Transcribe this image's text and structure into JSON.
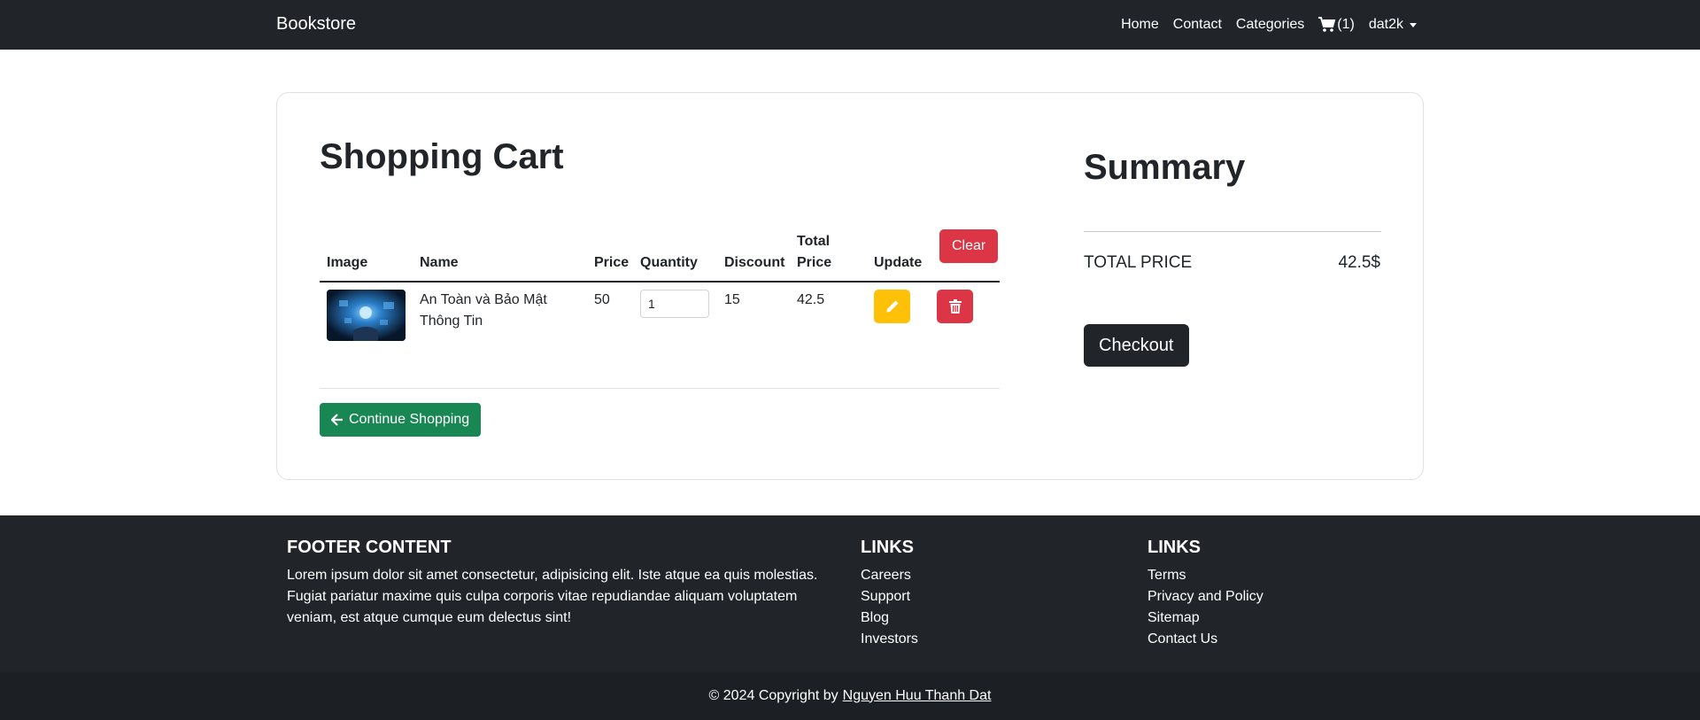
{
  "navbar": {
    "brand": "Bookstore",
    "links": {
      "home": "Home",
      "contact": "Contact",
      "categories": "Categories"
    },
    "cart_count": "(1)",
    "user": "dat2k"
  },
  "cart": {
    "title": "Shopping Cart",
    "headers": {
      "image": "Image",
      "name": "Name",
      "price": "Price",
      "quantity": "Quantity",
      "discount": "Discount",
      "total_line1": "Total",
      "total_line2": "Price",
      "update": "Update"
    },
    "clear_label": "Clear",
    "items": [
      {
        "name_line1": "An Toàn và Bảo Mật",
        "name_line2": "Thông Tin",
        "price": "50",
        "quantity": "1",
        "discount": "15",
        "total": "42.5"
      }
    ],
    "continue_label": "Continue Shopping"
  },
  "summary": {
    "title": "Summary",
    "total_label": "TOTAL PRICE",
    "total_value": "42.5$",
    "checkout_label": "Checkout"
  },
  "footer": {
    "content_title": "FOOTER CONTENT",
    "content_text": "Lorem ipsum dolor sit amet consectetur, adipisicing elit. Iste atque ea quis molestias. Fugiat pariatur maxime quis culpa corporis vitae repudiandae aliquam voluptatem veniam, est atque cumque eum delectus sint!",
    "links1_title": "LINKS",
    "links1": [
      "Careers",
      "Support",
      "Blog",
      "Investors"
    ],
    "links2_title": "LINKS",
    "links2": [
      "Terms",
      "Privacy and Policy",
      "Sitemap",
      "Contact Us"
    ],
    "copyright_prefix": "© 2024 Copyright by",
    "copyright_author": "Nguyen Huu Thanh Dat"
  },
  "colors": {
    "dark": "#212529",
    "danger": "#dc3545",
    "warning": "#ffc107",
    "success": "#198754"
  },
  "icons": [
    "cart-icon",
    "caret-down-icon",
    "pencil-icon",
    "trash-icon",
    "arrow-left-icon",
    "book-cover-image"
  ]
}
